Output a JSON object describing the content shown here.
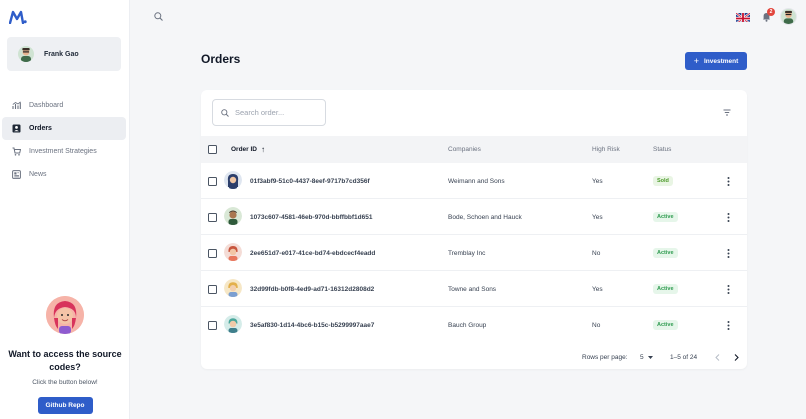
{
  "user": {
    "name": "Frank Gao"
  },
  "sidebar": {
    "items": [
      {
        "label": "Dashboard",
        "icon": "chart-icon",
        "active": false
      },
      {
        "label": "Orders",
        "icon": "orders-icon",
        "active": true
      },
      {
        "label": "Investment Strategies",
        "icon": "cart-icon",
        "active": false
      },
      {
        "label": "News",
        "icon": "news-icon",
        "active": false
      }
    ]
  },
  "promo": {
    "title": "Want to access the source codes?",
    "subtitle": "Click the button below!",
    "button": "Github Repo"
  },
  "topbar": {
    "notification_count": "2",
    "language": "EN"
  },
  "page": {
    "title": "Orders",
    "action_button": "Investment"
  },
  "search": {
    "placeholder": "Search order..."
  },
  "table": {
    "columns": {
      "order_id": "Order ID",
      "companies": "Companies",
      "high_risk": "High Risk",
      "status": "Status"
    },
    "sort_indicator": "↑",
    "rows": [
      {
        "order_id": "01f3abf9-51c0-4437-8eef-9717b7cd356f",
        "company": "Weimann and Sons",
        "high_risk": "Yes",
        "status": "Sold"
      },
      {
        "order_id": "1073c607-4581-46eb-970d-bbffbbf1d651",
        "company": "Bode, Schoen and Hauck",
        "high_risk": "Yes",
        "status": "Active"
      },
      {
        "order_id": "2ee651d7-e017-41ce-bd74-ebdcecf4eadd",
        "company": "Tremblay Inc",
        "high_risk": "No",
        "status": "Active"
      },
      {
        "order_id": "32d99fdb-b0f8-4ed9-ad71-16312d2808d2",
        "company": "Towne and Sons",
        "high_risk": "Yes",
        "status": "Active"
      },
      {
        "order_id": "3e5af830-1d14-4bc6-b15c-b5299997aae7",
        "company": "Bauch Group",
        "high_risk": "No",
        "status": "Active"
      }
    ]
  },
  "pagination": {
    "rows_per_page_label": "Rows per page:",
    "rows_per_page": "5",
    "range": "1–5 of 24"
  },
  "colors": {
    "accent": "#2f5dc9",
    "status_green": "#2e9b4f",
    "badge_red": "#e2463d"
  }
}
